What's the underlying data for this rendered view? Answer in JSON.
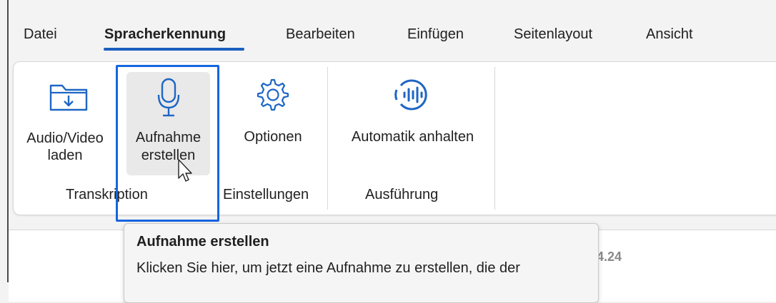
{
  "menu": {
    "tabs": [
      {
        "label": "Datei"
      },
      {
        "label": "Spracherkennung",
        "active": true
      },
      {
        "label": "Bearbeiten"
      },
      {
        "label": "Einfügen"
      },
      {
        "label": "Seitenlayout"
      },
      {
        "label": "Ansicht"
      }
    ]
  },
  "ribbon": {
    "groups": [
      {
        "label": "Transkription",
        "buttons": [
          {
            "icon": "folder-download-icon",
            "line1": "Audio/Video",
            "line2": "laden"
          },
          {
            "icon": "microphone-icon",
            "line1": "Aufnahme",
            "line2": "erstellen",
            "hovered": true
          }
        ]
      },
      {
        "label": "Einstellungen",
        "buttons": [
          {
            "icon": "gear-icon",
            "line1": "Optionen"
          }
        ]
      },
      {
        "label": "Ausführung",
        "buttons": [
          {
            "icon": "audio-waveform-icon",
            "line1": "Automatik anhalten"
          }
        ]
      }
    ]
  },
  "tooltip": {
    "title": "Aufnahme erstellen",
    "body": "Klicken Sie hier, um jetzt eine Aufnahme zu erstellen, die der"
  },
  "document": {
    "partial_date": "04.24"
  },
  "colors": {
    "accent": "#1a5fbf",
    "highlight": "#1565e0"
  }
}
